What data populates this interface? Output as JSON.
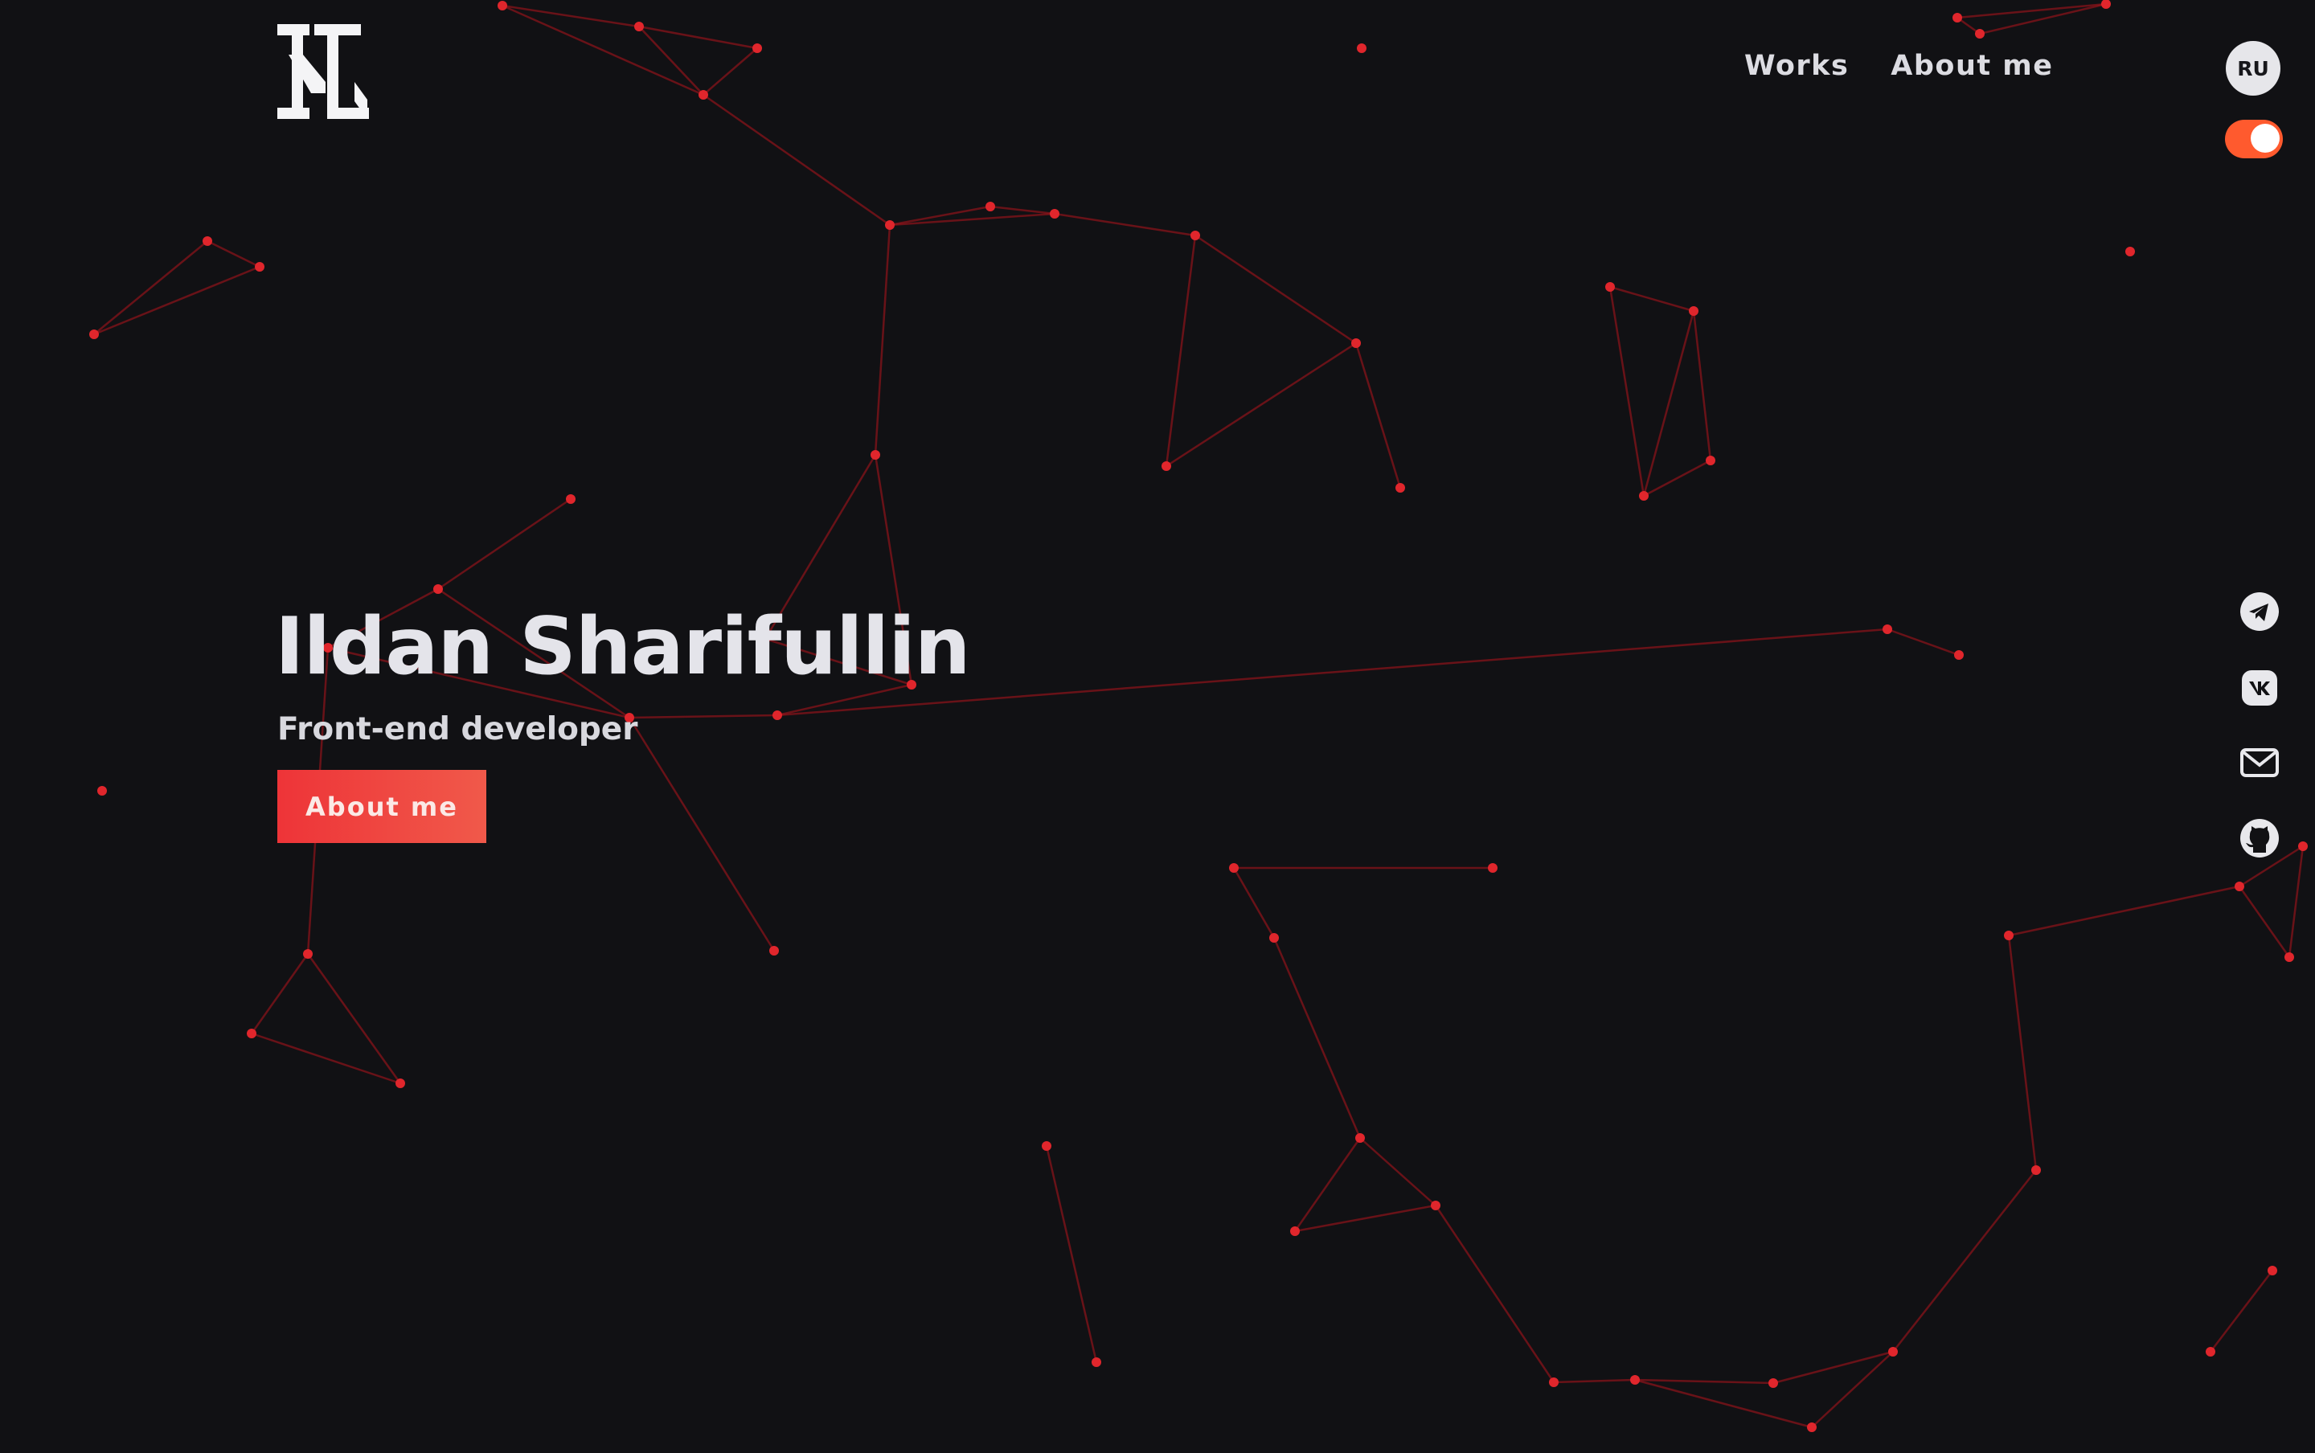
{
  "header": {
    "logo_icon": "il-monogram-logo",
    "nav": [
      {
        "label": "Works"
      },
      {
        "label": "About me"
      }
    ],
    "language_button": "RU",
    "theme_toggle": {
      "icon": "theme-toggle-switch",
      "state": "on"
    }
  },
  "hero": {
    "title": "Ildan Sharifullin",
    "subtitle": "Front-end developer",
    "cta_label": "About me"
  },
  "social": [
    {
      "icon": "telegram-icon"
    },
    {
      "icon": "vk-icon"
    },
    {
      "icon": "mail-icon"
    },
    {
      "icon": "github-icon"
    }
  ],
  "colors": {
    "background": "#111114",
    "accent": "#ee3438",
    "accent_gradient_end": "#f0594a",
    "toggle": "#ff5a2e",
    "network_node": "#e0262c",
    "text": "#e4e4ea"
  }
}
